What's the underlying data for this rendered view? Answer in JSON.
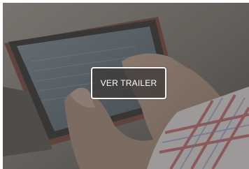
{
  "video_thumbnail": {
    "image_subject": "tablet-hands-photo",
    "overlay_color": "#3e3a37",
    "play_button": {
      "label": "VER TRAILER"
    }
  }
}
